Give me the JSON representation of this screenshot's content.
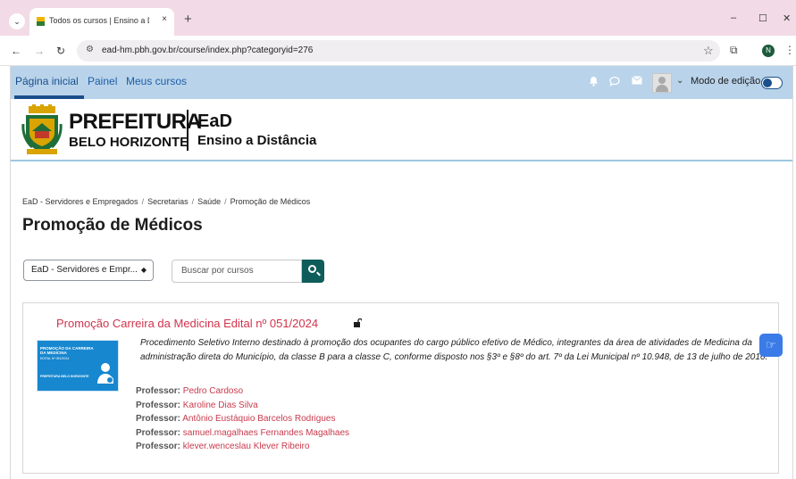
{
  "browser": {
    "tab_title": "Todos os cursos | Ensino a Distân",
    "tab_close": "×",
    "new_tab": "+",
    "minimize": "–",
    "maximize": "☐",
    "close": "✕",
    "url": "ead-hm.pbh.gov.br/course/index.php?categoryid=276",
    "profile_initial": "N"
  },
  "navbar": {
    "links": [
      "Página inicial",
      "Painel",
      "Meus cursos"
    ],
    "edit_mode_label": "Modo de edição",
    "edit_mode_on": true
  },
  "header": {
    "brand_line1": "PREFEITURA",
    "brand_line2": "BELO HORIZONTE",
    "ead_line1": "EaD",
    "ead_line2": "Ensino a Distância"
  },
  "breadcrumb": [
    "EaD - Servidores e Empregados",
    "Secretarias",
    "Saúde",
    "Promoção de Médicos"
  ],
  "page_title": "Promoção de Médicos",
  "filters": {
    "category_selected": "EaD - Servidores e Empr...",
    "search_placeholder": "Buscar por cursos"
  },
  "course": {
    "title": "Promoção Carreira da Medicina Edital nº 051/2024",
    "thumb_title": "PROMOÇÃO DA CARREIRA DA MEDICINA",
    "thumb_sub": "EDITAL Nº 051/2024",
    "thumb_logo": "PREFEITURA BELO HORIZONTE",
    "summary": "Procedimento Seletivo Interno destinado à promoção dos ocupantes do cargo público efetivo de Médico, integrantes da área de atividades de Medicina da administração direta do Município, da classe B para a classe C, conforme disposto nos §3º e §8º do art. 7º da Lei Municipal nº 10.948, de 13 de julho de 2016.",
    "teacher_label": "Professor:",
    "teachers": [
      "Pedro Cardoso",
      "Karoline Dias Silva",
      "Antônio Eustáquio Barcelos Rodrigues",
      "samuel.magalhaes Fernandes Magalhaes",
      "klever.wenceslau Klever Ribeiro"
    ]
  },
  "colors": {
    "navbar_bg": "#b9d3ea",
    "link": "#1c5fa8",
    "course_title": "#d1334c",
    "search_button": "#0f5d5a",
    "a11y_button": "#3a7be8"
  }
}
